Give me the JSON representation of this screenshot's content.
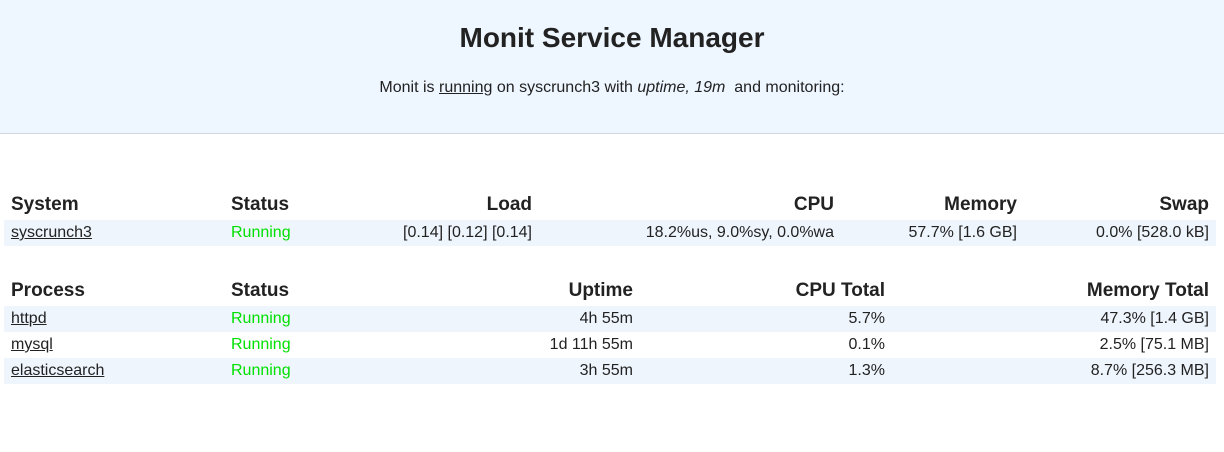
{
  "header": {
    "title": "Monit Service Manager",
    "prefix": "Monit is",
    "status_link": "running",
    "middle": "on syscrunch3 with",
    "uptime": "uptime, 19m",
    "suffix": "and monitoring:"
  },
  "system_table": {
    "headers": [
      "System",
      "Status",
      "Load",
      "CPU",
      "Memory",
      "Swap"
    ],
    "rows": [
      {
        "name": "syscrunch3",
        "status": "Running",
        "load": "[0.14] [0.12] [0.14]",
        "cpu": "18.2%us, 9.0%sy, 0.0%wa",
        "memory": "57.7% [1.6 GB]",
        "swap": "0.0% [528.0 kB]"
      }
    ]
  },
  "process_table": {
    "headers": [
      "Process",
      "Status",
      "Uptime",
      "CPU Total",
      "Memory Total"
    ],
    "rows": [
      {
        "name": "httpd",
        "status": "Running",
        "uptime": "4h 55m",
        "cpu_total": "5.7%",
        "memory_total": "47.3% [1.4 GB]"
      },
      {
        "name": "mysql",
        "status": "Running",
        "uptime": "1d 11h 55m",
        "cpu_total": "0.1%",
        "memory_total": "2.5% [75.1 MB]"
      },
      {
        "name": "elasticsearch",
        "status": "Running",
        "uptime": "3h 55m",
        "cpu_total": "1.3%",
        "memory_total": "8.7% [256.3 MB]"
      }
    ]
  },
  "colors": {
    "header_bg": "#eef6ff",
    "row_shade": "#eef5fd",
    "status_running": "#00e000"
  }
}
